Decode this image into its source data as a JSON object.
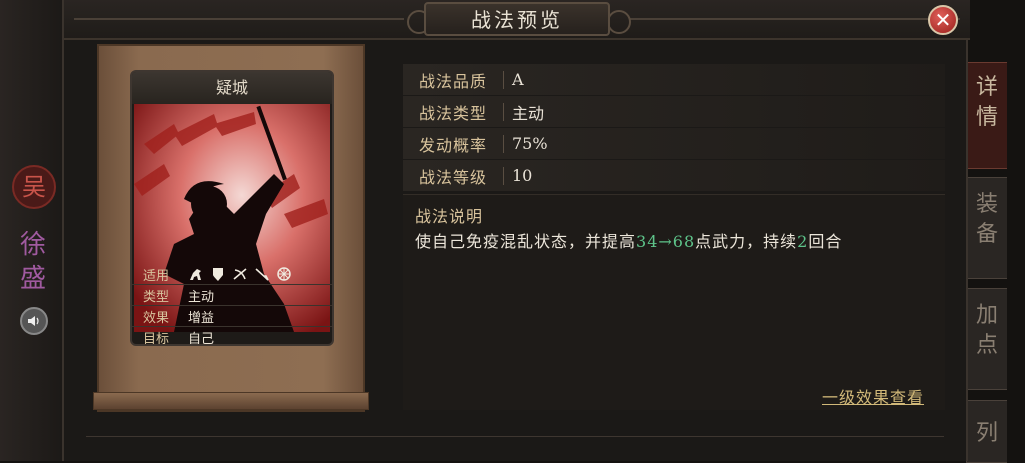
{
  "window": {
    "title": "战法预览",
    "close_glyph": "✕"
  },
  "background": {
    "seal_char": "吴",
    "name": "徐盛",
    "speaker_icon": "speaker-icon"
  },
  "side_tabs": [
    {
      "label": "详情",
      "active": true
    },
    {
      "label": "装备",
      "active": false
    },
    {
      "label": "加点",
      "active": false
    },
    {
      "label": "列",
      "active": false
    }
  ],
  "card": {
    "title": "疑城",
    "rows": {
      "apply_key": "适用",
      "type_key": "类型",
      "type_val": "主动",
      "effect_key": "效果",
      "effect_val": "增益",
      "target_key": "目标",
      "target_val": "自己"
    },
    "unit_icons": [
      "cavalry-icon",
      "shield-icon",
      "bow-icon",
      "spear-icon",
      "siege-icon"
    ]
  },
  "attributes": [
    {
      "key": "战法品质",
      "value": "A"
    },
    {
      "key": "战法类型",
      "value": "主动"
    },
    {
      "key": "发动概率",
      "value": "75%"
    },
    {
      "key": "战法等级",
      "value": "10"
    }
  ],
  "description": {
    "title": "战法说明",
    "text_before": "使自己免疫混乱状态，并提高",
    "value_from": "34",
    "arrow": "→",
    "value_to": "68",
    "text_middle": "点武力，持续",
    "duration": "2",
    "text_after": "回合"
  },
  "level_link": "一级效果查看",
  "colors": {
    "accent_gold": "#d8c39c",
    "highlight_green": "#5ec48a",
    "close_red": "#9a1e1a"
  }
}
